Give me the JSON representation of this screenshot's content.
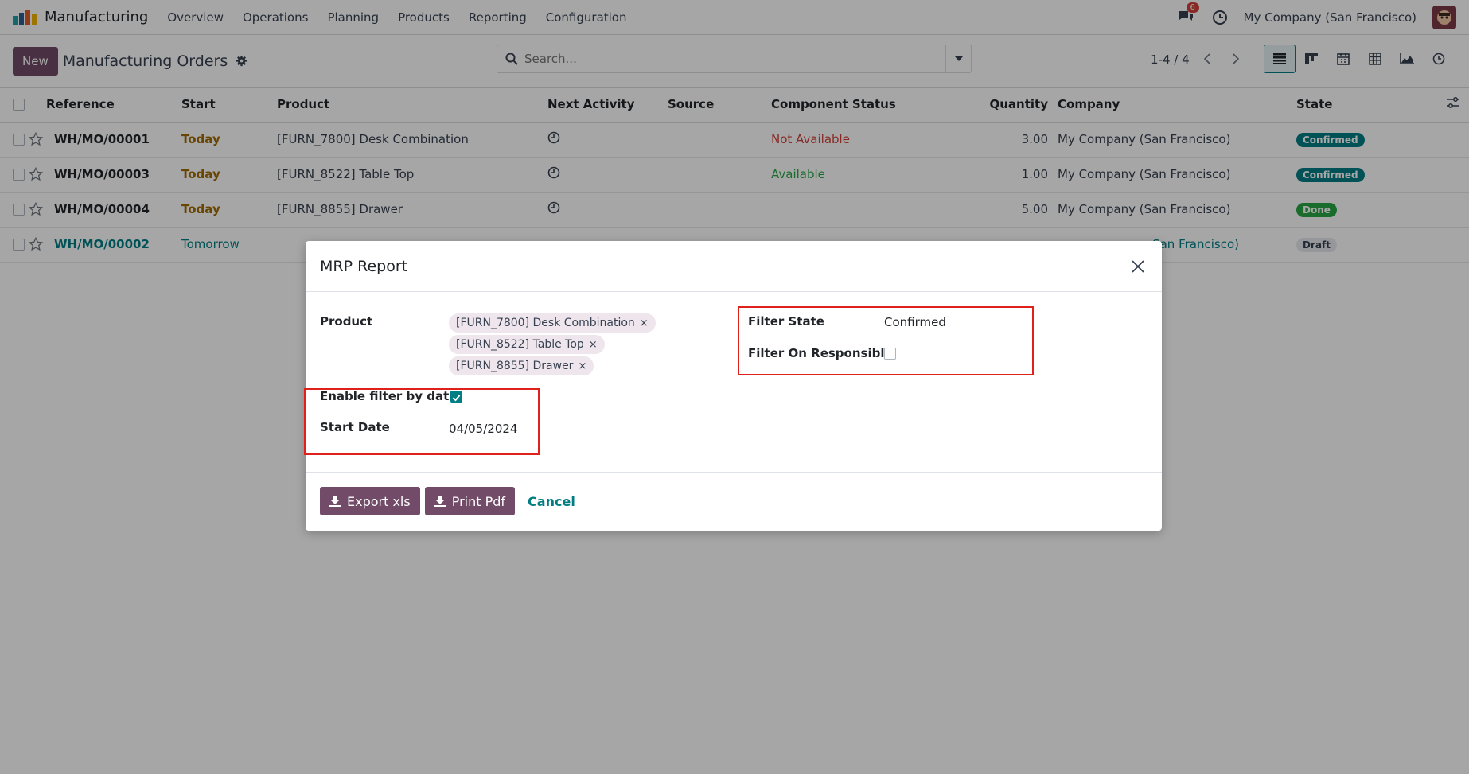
{
  "navbar": {
    "app_name": "Manufacturing",
    "menu": [
      "Overview",
      "Operations",
      "Planning",
      "Products",
      "Reporting",
      "Configuration"
    ],
    "chat_count": "6",
    "company": "My Company (San Francisco)"
  },
  "control": {
    "new_label": "New",
    "title": "Manufacturing Orders",
    "search_placeholder": "Search...",
    "pager": "1-4 / 4"
  },
  "table": {
    "headers": [
      "Reference",
      "Start",
      "Product",
      "Next Activity",
      "Source",
      "Component Status",
      "Quantity",
      "Company",
      "State"
    ],
    "rows": [
      {
        "reference": "WH/MO/00001",
        "start": "Today",
        "product": "[FURN_7800] Desk Combination",
        "component_status": "Not Available",
        "quantity": "3.00",
        "company": "My Company (San Francisco)",
        "state": "Confirmed"
      },
      {
        "reference": "WH/MO/00003",
        "start": "Today",
        "product": "[FURN_8522] Table Top",
        "component_status": "Available",
        "quantity": "1.00",
        "company": "My Company (San Francisco)",
        "state": "Confirmed"
      },
      {
        "reference": "WH/MO/00004",
        "start": "Today",
        "product": "[FURN_8855] Drawer",
        "component_status": "",
        "quantity": "5.00",
        "company": "My Company (San Francisco)",
        "state": "Done"
      },
      {
        "reference": "WH/MO/00002",
        "start": "Tomorrow",
        "product": "",
        "component_status": "",
        "quantity": "",
        "company": "San Francisco)",
        "state": "Draft"
      }
    ]
  },
  "modal": {
    "title": "MRP Report",
    "product_label": "Product",
    "products": [
      "[FURN_7800] Desk Combination",
      "[FURN_8522] Table Top",
      "[FURN_8855] Drawer"
    ],
    "enable_filter_label": "Enable filter by date",
    "enable_filter_checked": true,
    "start_date_label": "Start Date",
    "start_date": "04/05/2024",
    "filter_state_label": "Filter State",
    "filter_state": "Confirmed",
    "filter_responsible_label": "Filter On Responsible",
    "filter_responsible_checked": false,
    "export_label": "Export xls",
    "print_label": "Print Pdf",
    "cancel_label": "Cancel"
  }
}
